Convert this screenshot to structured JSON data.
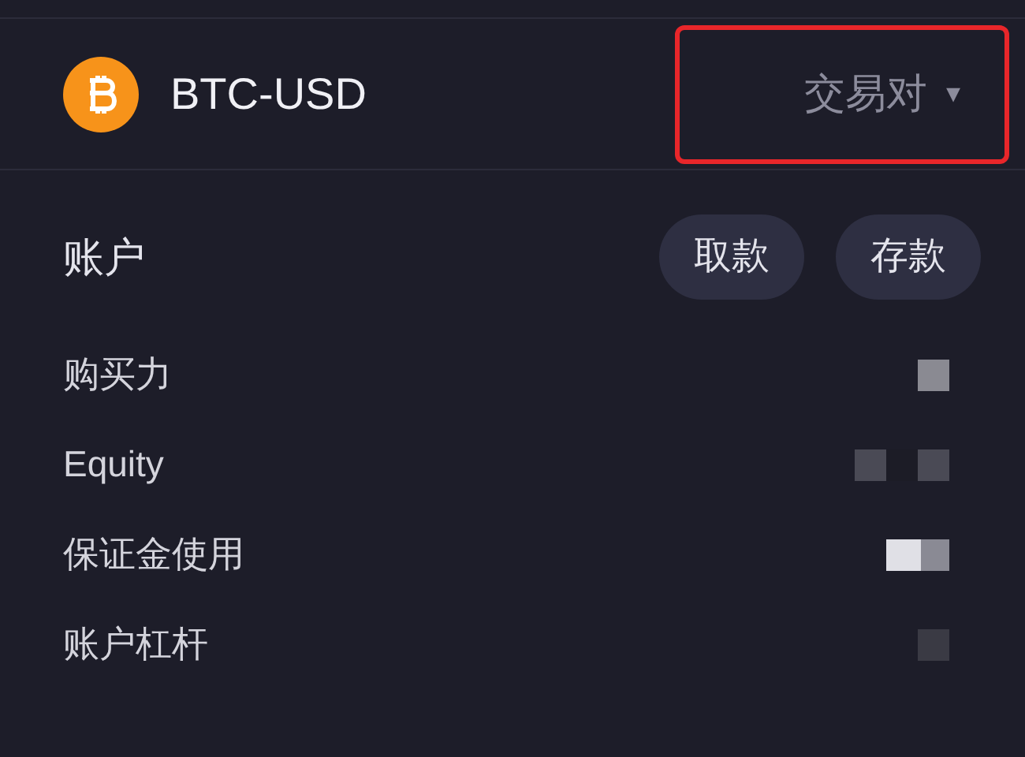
{
  "header": {
    "symbol": "BTC-USD",
    "selector": {
      "label": "交易对",
      "caret": "▾",
      "highlighted": true
    }
  },
  "account": {
    "title": "账户",
    "buttons": [
      "取款",
      "存款"
    ]
  },
  "rows": [
    {
      "label": "购买力",
      "value_hidden": true
    },
    {
      "label": "Equity",
      "value_hidden": true
    },
    {
      "label": "保证金使用",
      "value_hidden": true
    },
    {
      "label": "账户杠杆",
      "value_hidden": true
    }
  ]
}
